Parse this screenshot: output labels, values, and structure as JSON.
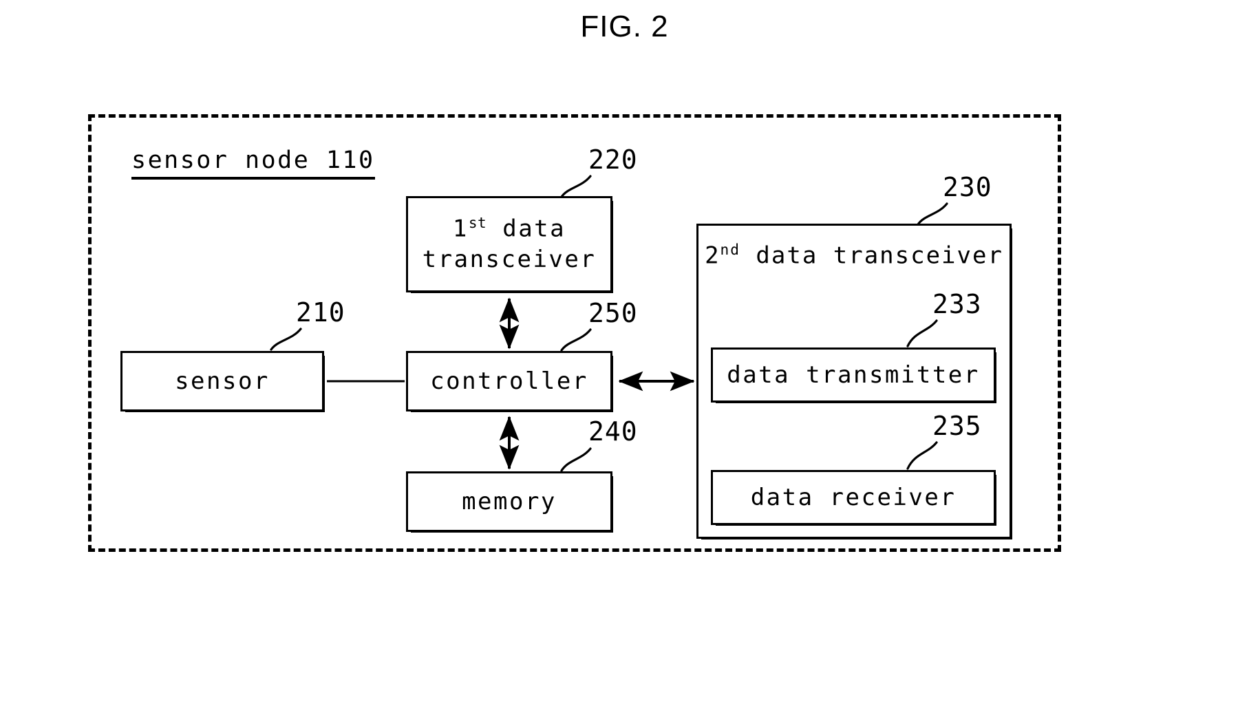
{
  "figure": {
    "title": "FIG. 2",
    "kind": "patent-block-diagram"
  },
  "enclosure": {
    "label": "sensor node 110",
    "reference": "110",
    "style": "dashed"
  },
  "blocks": [
    {
      "id": "sensor",
      "label": "sensor",
      "reference": "210"
    },
    {
      "id": "first_data_tx",
      "label_line1_prefix": "1",
      "label_line1_sup": "st",
      "label_line1_suffix": " data",
      "label_line2": "transceiver",
      "reference": "220"
    },
    {
      "id": "controller",
      "label": "controller",
      "reference": "250"
    },
    {
      "id": "memory",
      "label": "memory",
      "reference": "240"
    },
    {
      "id": "second_data_tx",
      "label_prefix": "2",
      "label_sup": "nd",
      "label_suffix": " data transceiver",
      "reference": "230"
    },
    {
      "id": "data_transmitter",
      "label": "data transmitter",
      "reference": "233"
    },
    {
      "id": "data_receiver",
      "label": "data receiver",
      "reference": "235"
    }
  ],
  "labels": {
    "sensor": "sensor",
    "controller": "controller",
    "memory": "memory",
    "data_transmitter": "data transmitter",
    "data_receiver": "data receiver",
    "first_tx_num": "1",
    "first_tx_sup": "st",
    "first_tx_rest": " data",
    "first_tx_line2": "transceiver",
    "second_tx_num": "2",
    "second_tx_sup": "nd",
    "second_tx_rest": " data transceiver"
  },
  "references": {
    "sensor": "210",
    "first_data_transceiver": "220",
    "second_data_transceiver": "230",
    "data_transmitter": "233",
    "data_receiver": "235",
    "memory": "240",
    "controller": "250"
  },
  "connections": [
    {
      "from": "sensor",
      "to": "controller",
      "arrow": "none"
    },
    {
      "from": "controller",
      "to": "first_data_tx",
      "arrow": "double"
    },
    {
      "from": "controller",
      "to": "memory",
      "arrow": "double"
    },
    {
      "from": "controller",
      "to": "second_data_tx",
      "arrow": "double"
    }
  ],
  "colors": {
    "ink": "#000000",
    "paper": "#ffffff"
  }
}
